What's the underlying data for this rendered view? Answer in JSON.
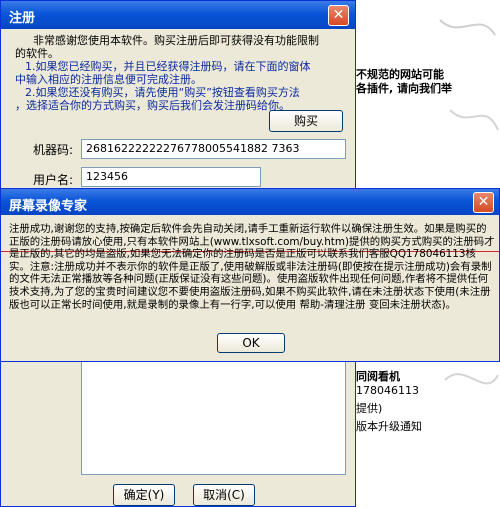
{
  "register": {
    "title": "注册",
    "intro": [
      "非常感谢您使用本软件。购买注册后即可获得没有功能限制",
      "的软件。",
      "1.如果您已经购买，并且已经获得注册码，请在下面的窗体",
      "中输入相应的注册信息便可完成注册。",
      "2.如果您还没有购买，请先使用“购买”按钮查看购买方法",
      "，选择适合你的方式购买，购买后我们会发注册码给你。"
    ],
    "buy_label": "购买",
    "machine_label": "机器码:",
    "machine_value": "26816222222276778005541882 7363",
    "username_label": "用户名:",
    "username_value": "123456",
    "ok_label": "确定(Y)",
    "cancel_label": "取消(C)"
  },
  "background": {
    "line1": "不规范的网站可能",
    "line2": "各插件, 请向我们举",
    "line3": "同阅看机",
    "line4": "178046113",
    "line5": "提供)",
    "line6": "版本升级通知"
  },
  "message": {
    "title": "屏幕录像专家",
    "body": "注册成功,谢谢您的支持,按确定后软件会先自动关闭,请手工重新运行软件以确保注册生效。如果是购买的正版的注册码请放心使用,只有本软件网站上(www.tlxsoft.com/buy.htm)提供的购买方式购买的注册码才是正版的,其它的均是盗版,如果您无法确定你的注册码是否是正版可以联系我们客服QQ178046113核实。注意:注册成功并不表示你的软件是正版了,使用破解版或非法注册码(即使按在提示注册成功)会有录制的文件无法正常播放等各种问题(正版保证没有这些问题)。使用盗版软件出现任何问题,作者将不提供任何技术支持,为了您的宝贵时间建议您不要使用盗版注册码,如果不购买此软件,请在未注册状态下使用(未注册版也可以正常长时间使用,就是录制的录像上有一行字,可以使用 帮助-清理注册 变回未注册状态)。",
    "ok_label": "OK"
  }
}
